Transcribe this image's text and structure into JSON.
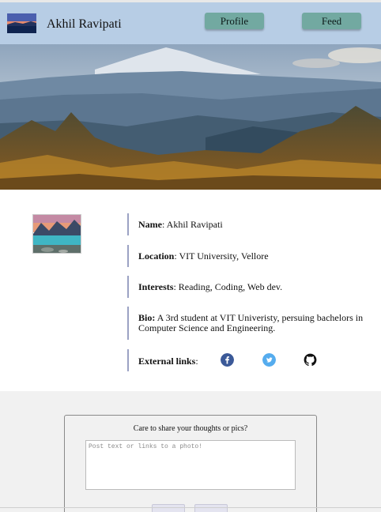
{
  "header": {
    "title": "Akhil Ravipati",
    "nav": [
      {
        "label": "Profile"
      },
      {
        "label": "Feed"
      }
    ]
  },
  "profile": {
    "rows": [
      {
        "label": "Name",
        "value": ": Akhil Ravipati"
      },
      {
        "label": "Location",
        "value": ": VIT University, Vellore"
      },
      {
        "label": "Interests",
        "value": ": Reading, Coding, Web dev."
      },
      {
        "label": "Bio:",
        "value": " A 3rd student at VIT Univeristy, persuing bachelors in Computer Science and Engineering."
      },
      {
        "label": "External links",
        "value": ":"
      }
    ],
    "social_icons": [
      "facebook-icon",
      "twitter-icon",
      "github-icon"
    ]
  },
  "post": {
    "prompt": "Care to share your thoughts or pics?",
    "placeholder": "Post text or links to a photo!"
  },
  "colors": {
    "header_bg": "#b7cde5",
    "nav_button": "#72a9a1",
    "divider": "#9ba2c4",
    "facebook": "#3b5998",
    "twitter": "#55acee"
  }
}
